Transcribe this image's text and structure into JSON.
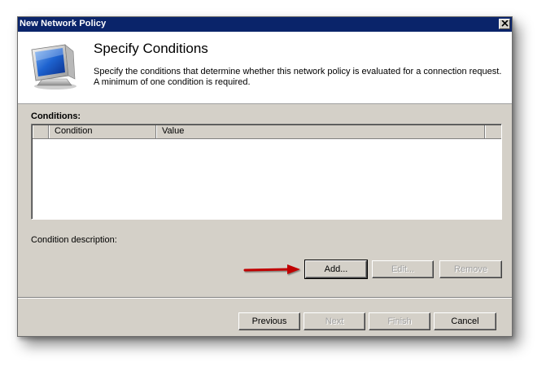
{
  "window": {
    "title": "New Network Policy"
  },
  "header": {
    "title": "Specify Conditions",
    "description_line1": "Specify the conditions that determine whether this network policy is evaluated for a connection request.",
    "description_line2": "A minimum of one condition is required.",
    "icon": "computer-monitor-icon"
  },
  "conditions": {
    "label": "Conditions:",
    "columns": [
      "",
      "Condition",
      "Value",
      ""
    ],
    "rows": []
  },
  "condition_description": {
    "label": "Condition description:"
  },
  "actions": {
    "add_label": "Add...",
    "edit_label": "Edit...",
    "remove_label": "Remove"
  },
  "footer": {
    "previous_label": "Previous",
    "next_label": "Next",
    "finish_label": "Finish",
    "cancel_label": "Cancel"
  },
  "annotation": {
    "arrow_color": "#c00000",
    "arrow_icon": "red-arrow-pointer-icon"
  },
  "colors": {
    "titlebar": "#0a246a",
    "dialog_face": "#d4d0c8",
    "header_bg": "#ffffff",
    "disabled_text": "#a0a0a0"
  }
}
